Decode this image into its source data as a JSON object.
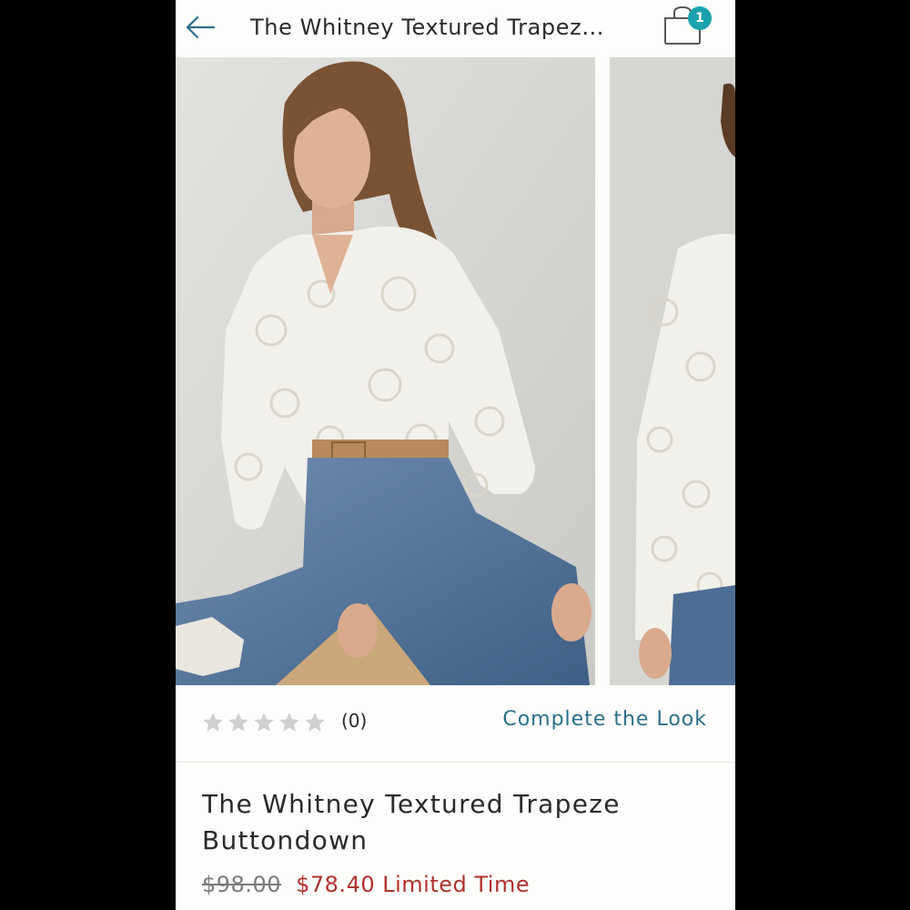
{
  "header": {
    "title": "The Whitney Textured Trapez...",
    "back_icon": "arrow-left-icon",
    "bag_icon": "shopping-bag-icon",
    "bag_count": "1",
    "accent": "#1aa3ad"
  },
  "carousel": {
    "images": [
      {
        "description_icon": "product-photo-front"
      },
      {
        "description_icon": "product-photo-side"
      }
    ]
  },
  "rating": {
    "stars": 0,
    "max_stars": 5,
    "count": "(0)",
    "complete_look": "Complete the Look",
    "link_color": "#2a6f8a"
  },
  "product": {
    "name": "The Whitney Textured Trapeze Buttondown",
    "original_price": "$98.00",
    "sale_price": "$78.40 Limited Time",
    "sale_color": "#b2312c"
  }
}
